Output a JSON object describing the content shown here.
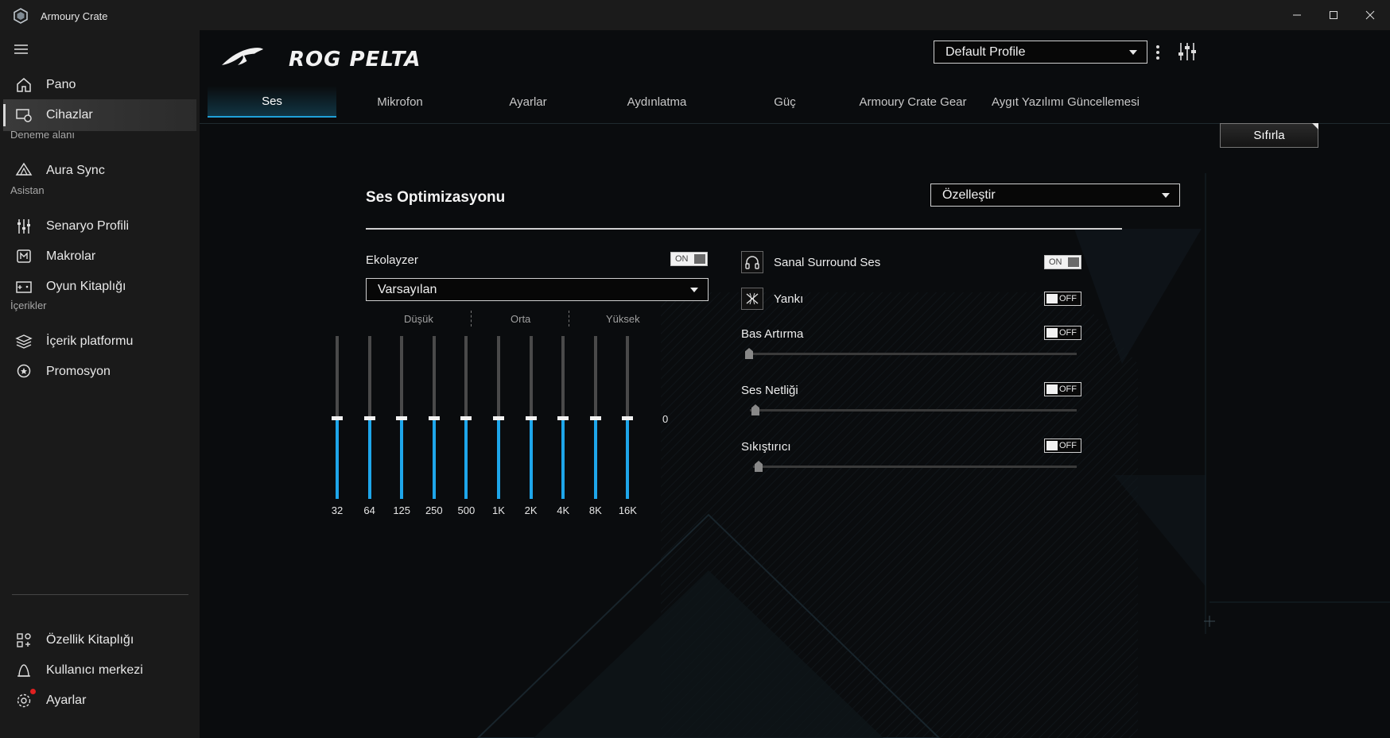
{
  "window": {
    "title": "Armoury Crate"
  },
  "sidebar": {
    "items_top": [
      {
        "label": "Pano",
        "icon": "home-icon"
      },
      {
        "label": "Cihazlar",
        "icon": "devices-icon",
        "active": true
      }
    ],
    "section_trial": "Deneme alanı",
    "trial_items": [
      {
        "label": "Aura Sync",
        "icon": "aura-sync-icon"
      }
    ],
    "section_assistant": "Asistan",
    "assistant_items": [
      {
        "label": "Senaryo Profili",
        "icon": "scenario-profile-icon"
      },
      {
        "label": "Makrolar",
        "icon": "macro-icon"
      },
      {
        "label": "Oyun Kitaplığı",
        "icon": "game-library-icon"
      }
    ],
    "section_content": "İçerikler",
    "content_items": [
      {
        "label": "İçerik platformu",
        "icon": "content-platform-icon"
      },
      {
        "label": "Promosyon",
        "icon": "promotion-icon"
      }
    ],
    "bottom_items": [
      {
        "label": "Özellik Kitaplığı",
        "icon": "feature-library-icon"
      },
      {
        "label": "Kullanıcı merkezi",
        "icon": "user-center-icon"
      },
      {
        "label": "Ayarlar",
        "icon": "settings-icon",
        "notification": true
      }
    ]
  },
  "header": {
    "device_name": "ROG PELTA",
    "profile_select": "Default Profile"
  },
  "tabs": [
    "Ses",
    "Mikrofon",
    "Ayarlar",
    "Aydınlatma",
    "Güç",
    "Armoury Crate Gear",
    "Aygıt Yazılımı Güncellemesi"
  ],
  "active_tab": "Ses",
  "reset_button": "Sıfırla",
  "sound_opt": {
    "title": "Ses Optimizasyonu",
    "mode_select": "Özelleştir"
  },
  "equalizer": {
    "label": "Ekolayzer",
    "toggle": "ON",
    "preset": "Varsayılan",
    "bands": [
      "Düşük",
      "Orta",
      "Yüksek"
    ],
    "zero_label": "0",
    "frequencies": [
      "32",
      "64",
      "125",
      "250",
      "500",
      "1K",
      "2K",
      "4K",
      "8K",
      "16K"
    ],
    "gains": [
      0,
      0,
      0,
      0,
      0,
      0,
      0,
      0,
      0,
      0
    ],
    "range": [
      -10,
      10
    ]
  },
  "effects": {
    "surround": {
      "label": "Sanal Surround Ses",
      "toggle": "ON"
    },
    "reverb": {
      "label": "Yankı",
      "toggle": "OFF"
    },
    "bass": {
      "label": "Bas Artırma",
      "toggle": "OFF",
      "level": 0
    },
    "clarity": {
      "label": "Ses Netliği",
      "toggle": "OFF",
      "level": 0
    },
    "compressor": {
      "label": "Sıkıştırıcı",
      "toggle": "OFF",
      "level": 0
    }
  },
  "colors": {
    "accent": "#1ea6ea",
    "background": "#0a0c0e",
    "sidebar": "#1a1a1a",
    "notification": "#e02020"
  }
}
